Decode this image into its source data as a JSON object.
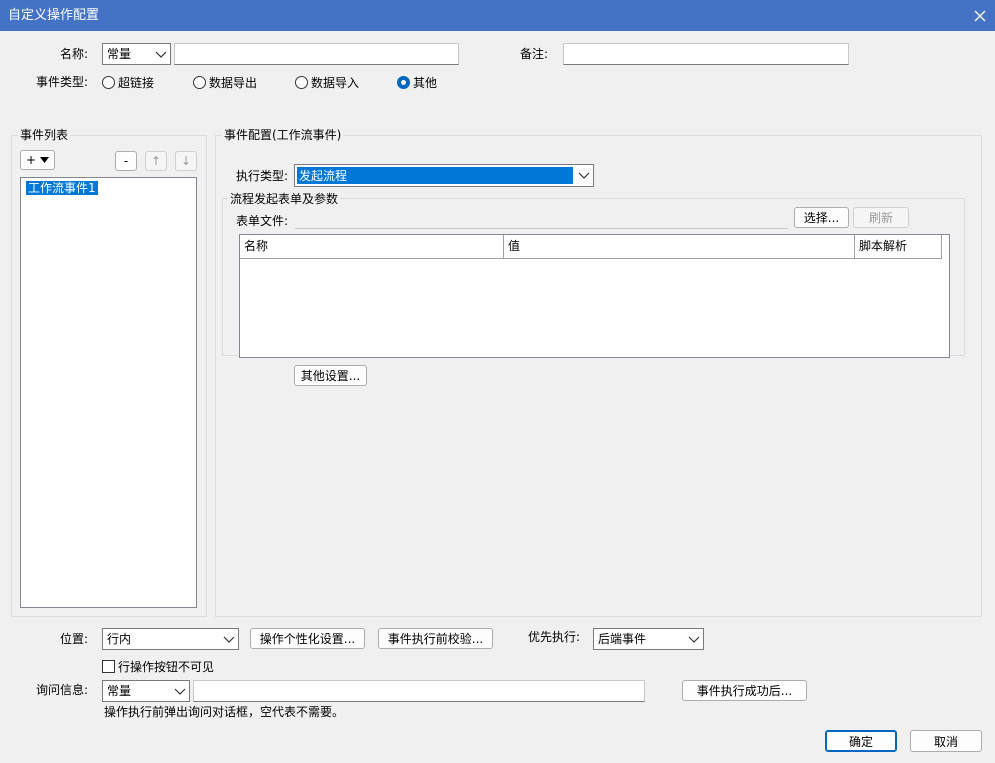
{
  "window": {
    "title": "自定义操作配置"
  },
  "top": {
    "name_label": "名称:",
    "name_type": "常量",
    "name_value": "",
    "remark_label": "备注:",
    "remark_value": "",
    "event_type_label": "事件类型:",
    "event_types": [
      {
        "label": "超链接",
        "selected": false
      },
      {
        "label": "数据导出",
        "selected": false
      },
      {
        "label": "数据导入",
        "selected": false
      },
      {
        "label": "其他",
        "selected": true
      }
    ]
  },
  "event_list": {
    "title": "事件列表",
    "add_label": "+",
    "remove_label": "-",
    "up_label": "↑",
    "down_label": "↓",
    "items": [
      {
        "label": "工作流事件1",
        "selected": true
      }
    ]
  },
  "event_config": {
    "title": "事件配置(工作流事件)",
    "exec_type_label": "执行类型:",
    "exec_type_value": "发起流程",
    "form_group_title": "流程发起表单及参数",
    "form_file_label": "表单文件:",
    "form_file_value": "",
    "select_label": "选择...",
    "refresh_label": "刷新",
    "table": {
      "columns": [
        "名称",
        "值",
        "脚本解析"
      ],
      "rows": []
    },
    "other_settings_label": "其他设置..."
  },
  "bottom": {
    "position_label": "位置:",
    "position_value": "行内",
    "personalize_label": "操作个性化设置...",
    "pre_check_label": "事件执行前校验...",
    "priority_label": "优先执行:",
    "priority_value": "后端事件",
    "hidden_check_label": "行操作按钮不可见",
    "hidden_checked": false,
    "confirm_msg_label": "询问信息:",
    "confirm_msg_type": "常量",
    "confirm_msg_value": "",
    "after_success_label": "事件执行成功后...",
    "hint": "操作执行前弹出询问对话框，空代表不需要。"
  },
  "footer": {
    "ok_label": "确定",
    "cancel_label": "取消"
  },
  "colors": {
    "titlebar": "#4472c4",
    "selection": "#0078d7",
    "accent": "#0067c0"
  }
}
